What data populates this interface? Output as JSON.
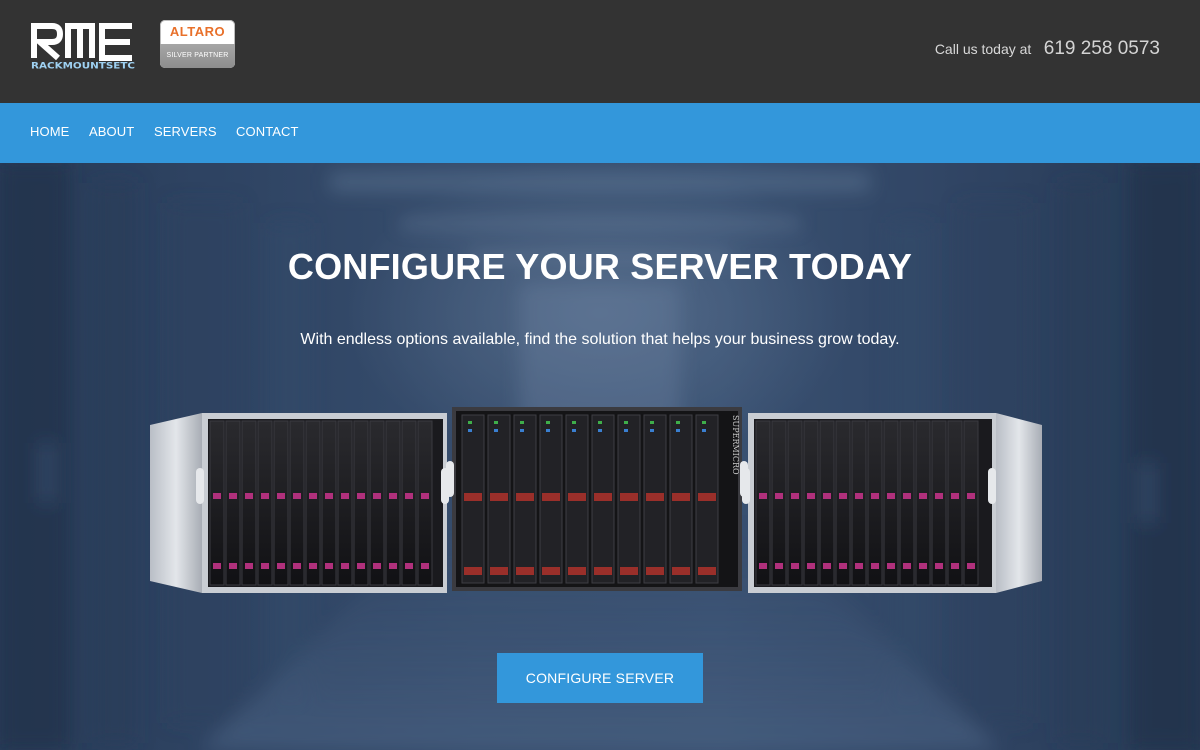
{
  "header": {
    "logo": {
      "wordmark": "RACKMOUNTSETC",
      "icon": "rme-logo-icon"
    },
    "partner": {
      "name": "ALTARO",
      "tier": "SILVER PARTNER"
    },
    "phone": {
      "label": "Call us today at",
      "number": "619 258 0573"
    }
  },
  "nav": {
    "items": [
      {
        "label": "HOME"
      },
      {
        "label": "ABOUT"
      },
      {
        "label": "SERVERS"
      },
      {
        "label": "CONTACT"
      }
    ]
  },
  "hero": {
    "title": "CONFIGURE YOUR SERVER TODAY",
    "subtitle": "With endless options available, find the solution that helps your business grow today.",
    "cta_label": "CONFIGURE SERVER",
    "server_brand": "SUPERMICRO"
  },
  "colors": {
    "header_bg": "#333333",
    "nav_bg": "#3397db",
    "accent": "#3397db",
    "partner_orange": "#e8702a"
  }
}
